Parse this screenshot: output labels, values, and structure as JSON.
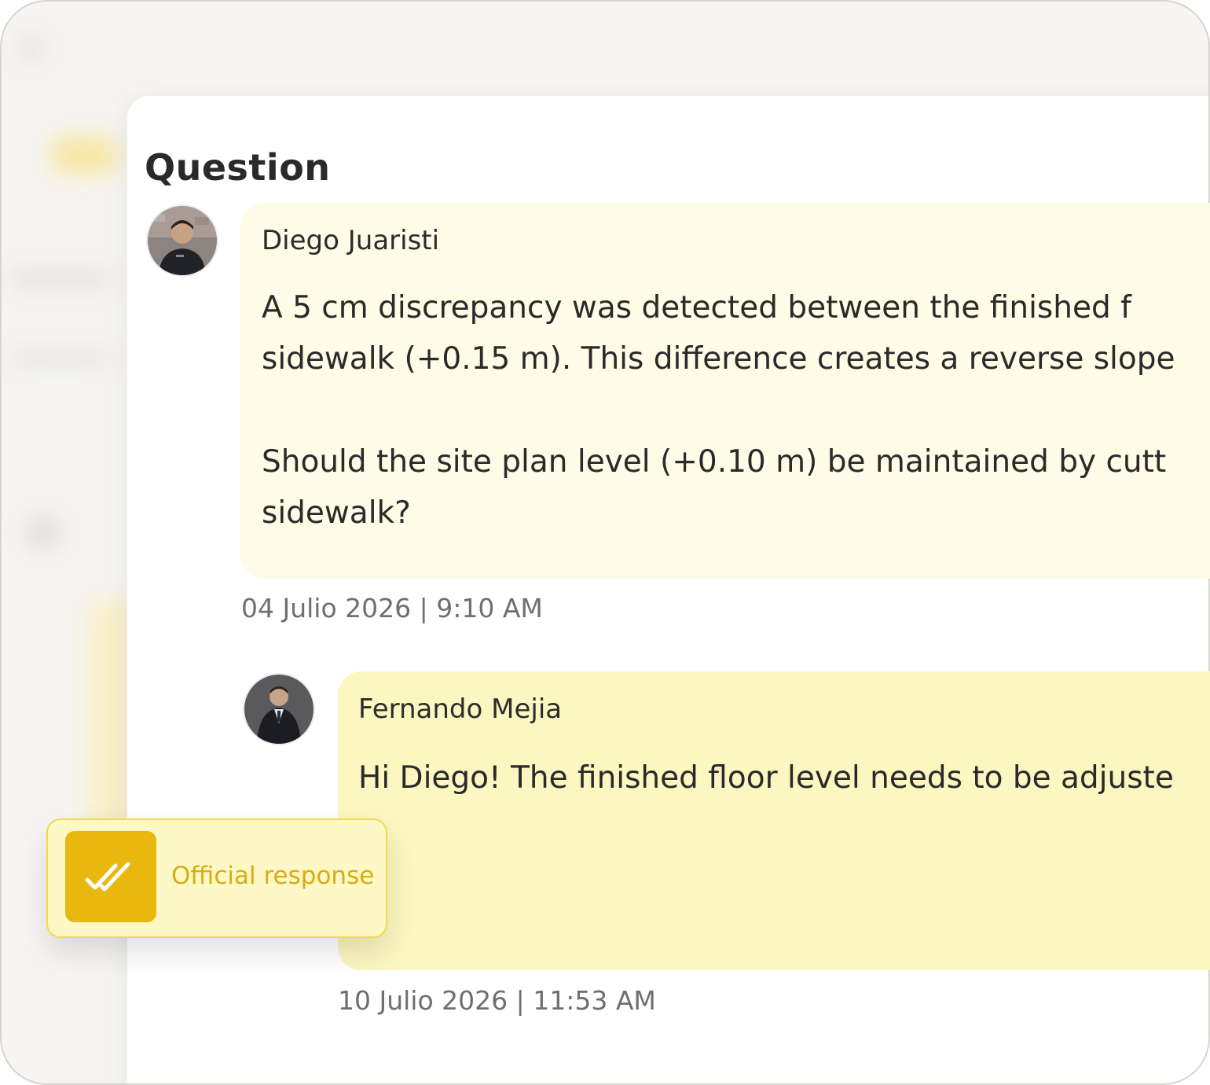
{
  "page": {
    "heading": "Question"
  },
  "thread": [
    {
      "author": "Diego Juaristi",
      "avatar_icon": "person-photo-avatar",
      "lines": [
        "A 5 cm discrepancy was detected between the finished f",
        "sidewalk (+0.15 m). This difference creates a reverse slope",
        "Should the site plan level (+0.10 m) be maintained by cutt",
        "sidewalk?"
      ],
      "timestamp": "04 Julio 2026 | 9:10 AM"
    },
    {
      "author": "Fernando Mejia",
      "avatar_icon": "person-photo-avatar",
      "lines": [
        "Hi Diego! The finished floor level needs to be adjuste"
      ],
      "timestamp": "10 Julio 2026 | 11:53 AM"
    }
  ],
  "badge": {
    "label": "Official response",
    "icon": "double-check-icon"
  },
  "colors": {
    "question_bubble": "#fefbe6",
    "answer_bubble": "#fcf6c1",
    "accent": "#e8b80e",
    "badge_text": "#d9ad0f"
  }
}
